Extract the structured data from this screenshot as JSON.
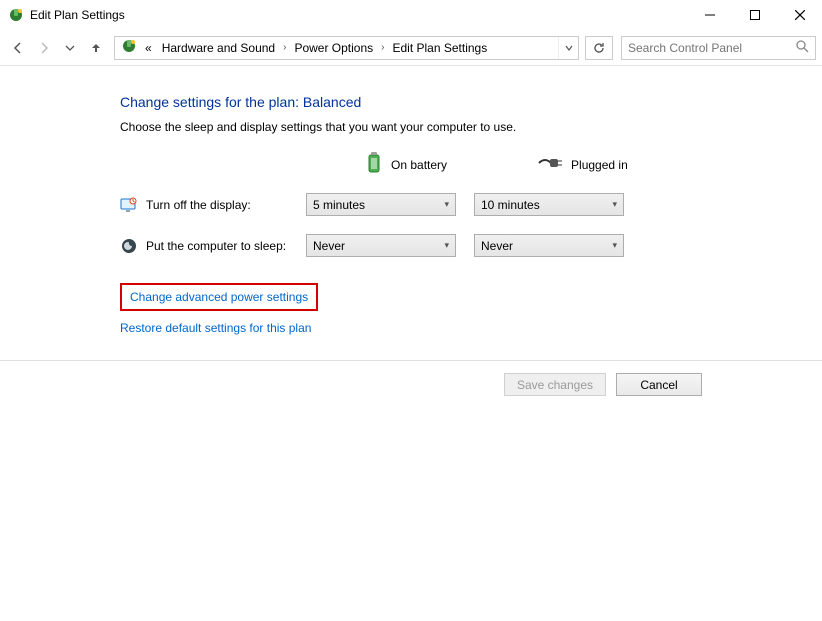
{
  "window": {
    "title": "Edit Plan Settings"
  },
  "breadcrumbs": {
    "prefix": "«",
    "items": [
      "Hardware and Sound",
      "Power Options",
      "Edit Plan Settings"
    ]
  },
  "search": {
    "placeholder": "Search Control Panel"
  },
  "page": {
    "heading": "Change settings for the plan: Balanced",
    "subtext": "Choose the sleep and display settings that you want your computer to use.",
    "col_battery": "On battery",
    "col_plugged": "Plugged in"
  },
  "settings": {
    "display": {
      "label": "Turn off the display:",
      "battery": "5 minutes",
      "plugged": "10 minutes"
    },
    "sleep": {
      "label": "Put the computer to sleep:",
      "battery": "Never",
      "plugged": "Never"
    }
  },
  "links": {
    "advanced": "Change advanced power settings",
    "restore": "Restore default settings for this plan"
  },
  "buttons": {
    "save": "Save changes",
    "cancel": "Cancel"
  }
}
